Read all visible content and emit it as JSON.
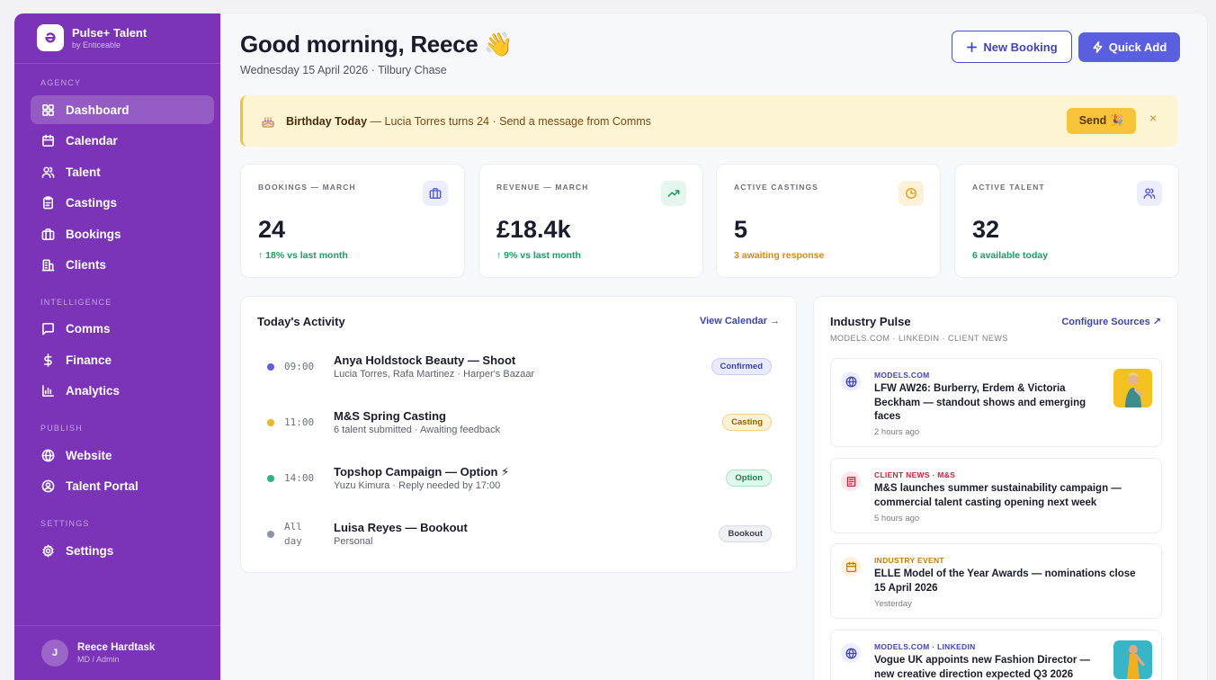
{
  "brand": {
    "name": "Pulse+ Talent",
    "sub": "by Enticeable"
  },
  "sidebar": {
    "sections": [
      "AGENCY",
      "INTELLIGENCE",
      "PUBLISH",
      "SETTINGS"
    ],
    "items": [
      {
        "label": "Dashboard",
        "icon": "dashboard-icon",
        "active": true
      },
      {
        "label": "Calendar",
        "icon": "calendar-icon"
      },
      {
        "label": "Talent",
        "icon": "users-icon"
      },
      {
        "label": "Castings",
        "icon": "clipboard-icon"
      },
      {
        "label": "Bookings",
        "icon": "briefcase-icon"
      },
      {
        "label": "Clients",
        "icon": "building-icon"
      },
      {
        "label": "Comms",
        "icon": "message-icon"
      },
      {
        "label": "Finance",
        "icon": "dollar-icon"
      },
      {
        "label": "Analytics",
        "icon": "bar-chart-icon"
      },
      {
        "label": "Website",
        "icon": "globe-icon"
      },
      {
        "label": "Talent Portal",
        "icon": "user-circle-icon"
      },
      {
        "label": "Settings",
        "icon": "gear-icon"
      }
    ]
  },
  "user": {
    "initial": "J",
    "name": "Reece Hardtask",
    "role": "MD / Admin"
  },
  "header": {
    "greeting": "Good morning, Reece 👋",
    "subline": "Wednesday 15 April 2026 · Tilbury Chase",
    "new_booking": "New Booking",
    "quick_add": "Quick Add"
  },
  "banner": {
    "bold": "Birthday Today",
    "text": " — Lucia Torres turns 24 · Send a message from Comms",
    "send": "Send 🎉",
    "close": "×"
  },
  "stats": [
    {
      "label": "BOOKINGS — MARCH",
      "value": "24",
      "sub": "↑ 18% vs last month",
      "sub_color": "#1a9c63",
      "icon": "briefcase-icon",
      "icon_bg": "#eceefe",
      "icon_color": "#5a5fe0"
    },
    {
      "label": "REVENUE — MARCH",
      "value": "£18.4k",
      "sub": "↑ 9% vs last month",
      "sub_color": "#1a9c63",
      "icon": "trend-up-icon",
      "icon_bg": "#e4f6ee",
      "icon_color": "#1a9c63"
    },
    {
      "label": "ACTIVE CASTINGS",
      "value": "5",
      "sub": "3 awaiting response",
      "sub_color": "#d98a0b",
      "icon": "clock-icon",
      "icon_bg": "#fdf2d9",
      "icon_color": "#e4a11b"
    },
    {
      "label": "ACTIVE TALENT",
      "value": "32",
      "sub": "6 available today",
      "sub_color": "#1a9c63",
      "icon": "users-icon",
      "icon_bg": "#eceefe",
      "icon_color": "#5a5fe0"
    }
  ],
  "activity": {
    "title": "Today's Activity",
    "link": "View Calendar →",
    "items": [
      {
        "time": "09:00",
        "title": "Anya Holdstock Beauty — Shoot",
        "sub": "Lucia Torres, Rafa Martinez · Harper's Bazaar",
        "badge": "Confirmed",
        "dot": "#5a5fe0",
        "badge_bg": "#e9ebfd",
        "badge_fg": "#3b43b5",
        "badge_border": "#c9cdf6"
      },
      {
        "time": "11:00",
        "title": "M&S Spring Casting",
        "sub": "6 talent submitted · Awaiting feedback",
        "badge": "Casting",
        "dot": "#f0b429",
        "badge_bg": "#fdf1d3",
        "badge_fg": "#9a5d07",
        "badge_border": "#f2d48a"
      },
      {
        "time": "14:00",
        "title": "Topshop Campaign — Option ⚡",
        "sub": "Yuzu Kimura · Reply needed by 17:00",
        "badge": "Option",
        "dot": "#2bb673",
        "badge_bg": "#e2f6ec",
        "badge_fg": "#178553",
        "badge_border": "#a9e3c6"
      },
      {
        "time": "All",
        "time2": "day",
        "title": "Luisa Reyes — Bookout",
        "sub": "Personal",
        "badge": "Bookout",
        "dot": "#8e94a8",
        "badge_bg": "#eff0f4",
        "badge_fg": "#3c3f52",
        "badge_border": "#d8dae3"
      }
    ]
  },
  "pulse": {
    "title": "Industry Pulse",
    "sub": "MODELS.COM · LINKEDIN · CLIENT NEWS",
    "link": "Configure Sources ↗",
    "items": [
      {
        "source": "MODELS.COM",
        "title": "LFW AW26: Burberry, Erdem & Victoria Beckham — standout shows and emerging faces",
        "time": "2 hours ago",
        "icon": "globe-icon",
        "color": "#4046b8",
        "icon_bg": "#eceefe"
      },
      {
        "source": "CLIENT NEWS · M&S",
        "title": "M&S launches summer sustainability campaign — commercial talent casting opening next week",
        "time": "5 hours ago",
        "icon": "newspaper-icon",
        "color": "#c7263a",
        "icon_bg": "#fde7ea"
      },
      {
        "source": "INDUSTRY EVENT",
        "title": "ELLE Model of the Year Awards — nominations close 15 April 2026",
        "time": "Yesterday",
        "icon": "calendar-icon",
        "color": "#c77a06",
        "icon_bg": "#fdf2d9"
      },
      {
        "source": "MODELS.COM · LINKEDIN",
        "title": "Vogue UK appoints new Fashion Director — new creative direction expected Q3 2026",
        "time": "",
        "icon": "globe-icon",
        "color": "#4046b8",
        "icon_bg": "#eceefe"
      }
    ]
  }
}
